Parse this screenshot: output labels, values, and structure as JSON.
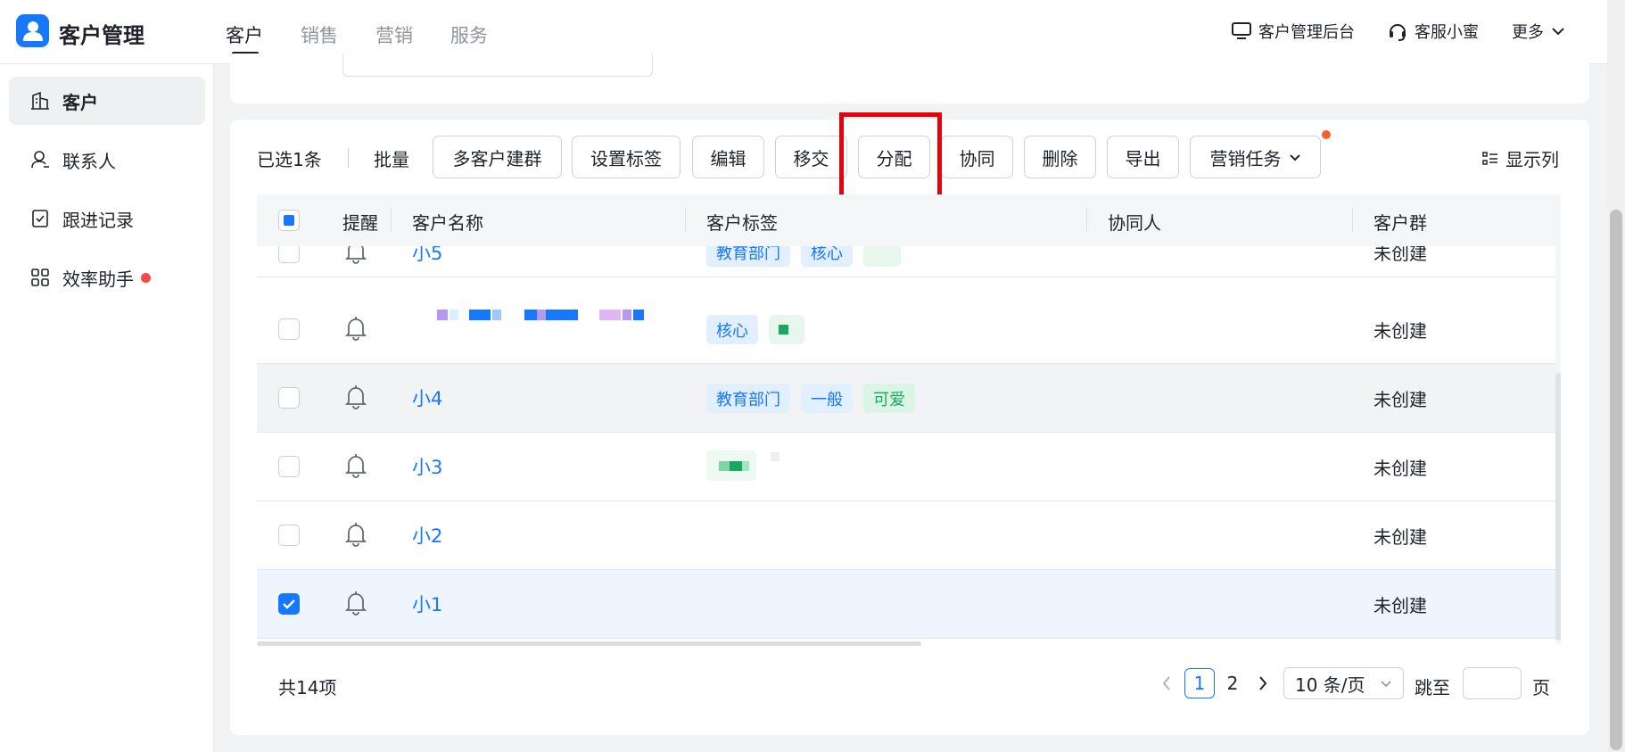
{
  "header": {
    "app_title": "客户管理",
    "tabs": [
      {
        "label": "客户"
      },
      {
        "label": "销售"
      },
      {
        "label": "营销"
      },
      {
        "label": "服务"
      }
    ],
    "admin_label": "客户管理后台",
    "support_label": "客服小蜜",
    "more_label": "更多"
  },
  "sidebar": {
    "items": [
      {
        "label": "客户",
        "icon": "building-icon"
      },
      {
        "label": "联系人",
        "icon": "contact-icon"
      },
      {
        "label": "跟进记录",
        "icon": "checklist-icon"
      },
      {
        "label": "效率助手",
        "icon": "grid-icon"
      }
    ]
  },
  "toolbar": {
    "selected_count": "已选1条",
    "batch_label": "批量",
    "buttons": {
      "multi_group": "多客户建群",
      "set_tags": "设置标签",
      "edit": "编辑",
      "transfer": "移交",
      "assign": "分配",
      "collab": "协同",
      "delete": "删除",
      "export": "导出",
      "marketing": "营销任务"
    },
    "show_columns": "显示列"
  },
  "table": {
    "columns": {
      "remind": "提醒",
      "name": "客户名称",
      "tags": "客户标签",
      "collaborator": "协同人",
      "group": "客户群"
    },
    "rows": [
      {
        "name": "小5",
        "tags": [
          "教育部门",
          "核心"
        ],
        "group": "未创建"
      },
      {
        "name": "",
        "tags": [
          "核心"
        ],
        "group": "未创建"
      },
      {
        "name": "小4",
        "tags": [
          "教育部门",
          "一般",
          "可爱"
        ],
        "group": "未创建"
      },
      {
        "name": "小3",
        "tags": [],
        "group": "未创建"
      },
      {
        "name": "小2",
        "tags": [],
        "group": "未创建"
      },
      {
        "name": "小1",
        "tags": [],
        "group": "未创建"
      }
    ]
  },
  "pagination": {
    "total": "共14项",
    "pages": [
      "1",
      "2"
    ],
    "current_page": "1",
    "page_size": "10 条/页",
    "jump_label": "跳至",
    "page_suffix": "页"
  },
  "colors": {
    "primary": "#1677ff",
    "highlight": "#e8000b",
    "dot": "#f54a45"
  }
}
